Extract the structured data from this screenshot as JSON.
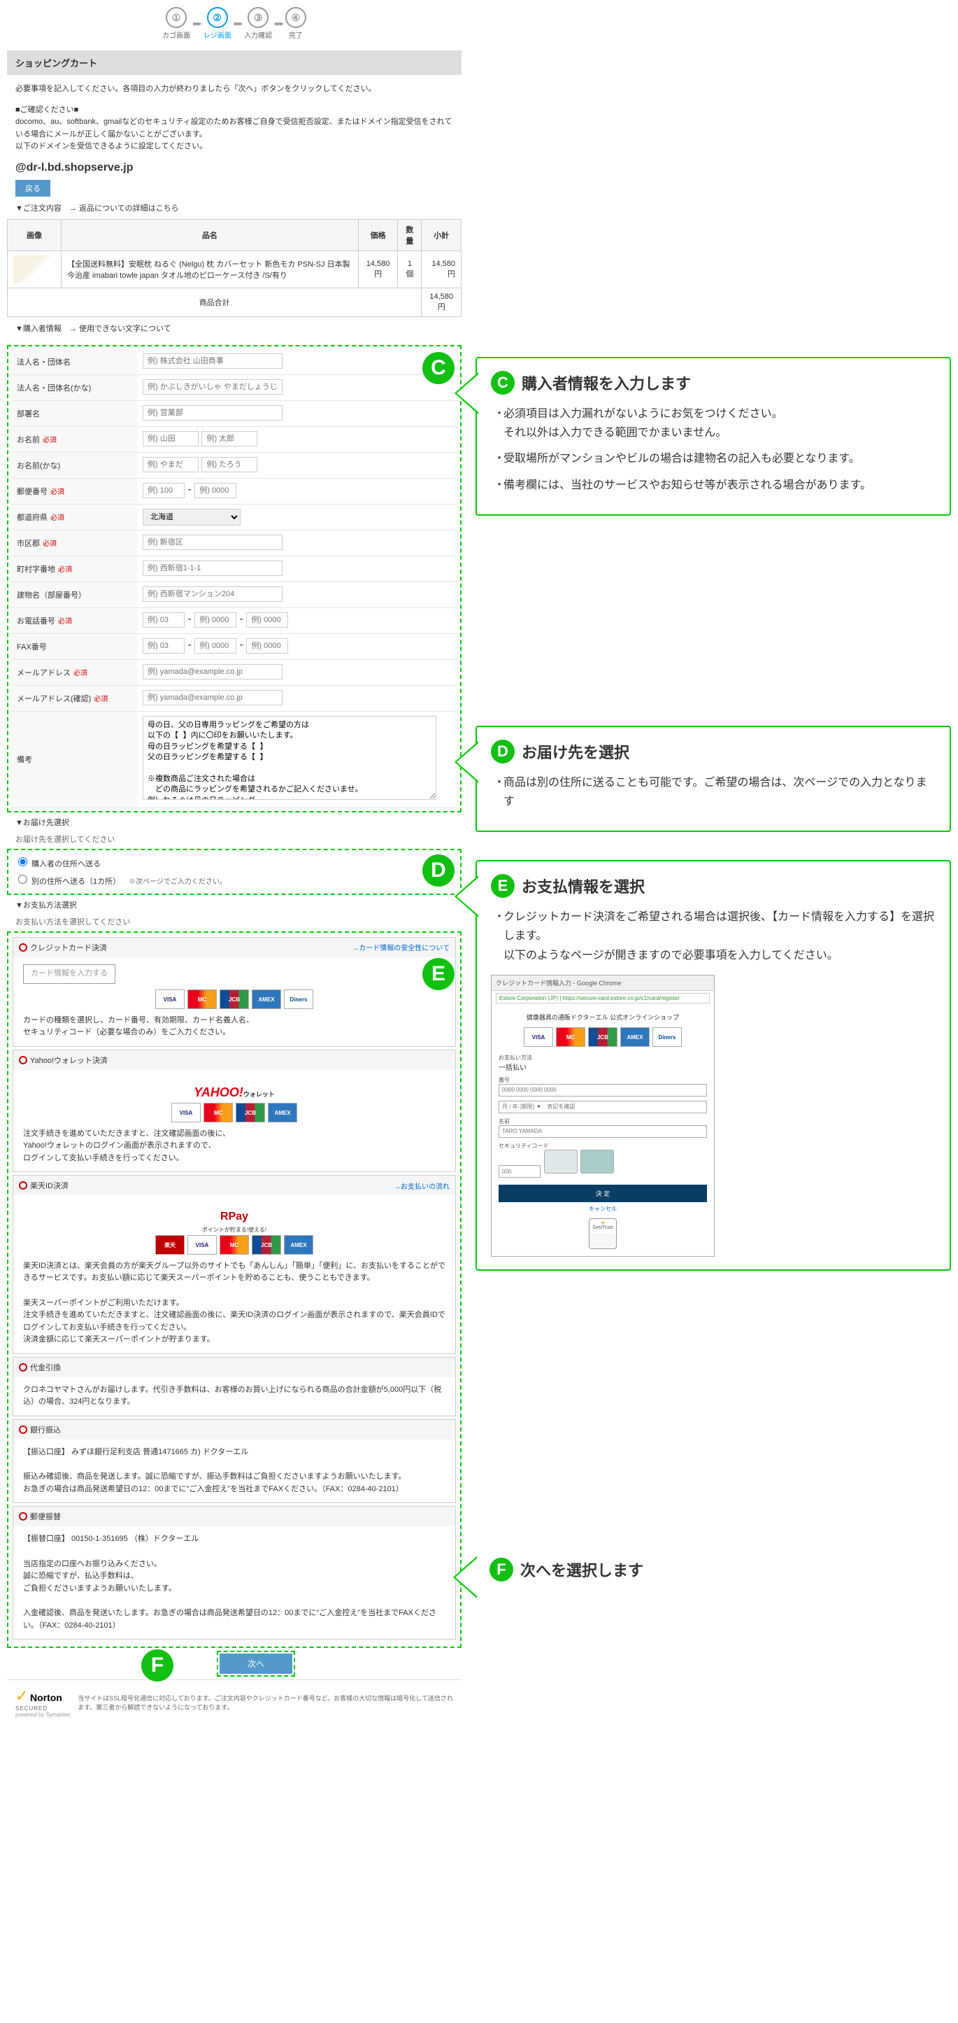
{
  "steps": [
    {
      "num": "①",
      "label": "カゴ画面"
    },
    {
      "num": "②",
      "label": "レジ画面"
    },
    {
      "num": "③",
      "label": "入力確認"
    },
    {
      "num": "④",
      "label": "完了"
    }
  ],
  "cart_header": "ショッピングカート",
  "intro": "必要事項を記入してください。各項目の入力が終わりましたら「次へ」ボタンをクリックしてください。",
  "confirm_title": "■ご確認ください■",
  "confirm_body": "docomo、au、softbank、gmailなどのセキュリティ設定のためお客様ご自身で受信拒否設定、またはドメイン指定受信をされている場合にメールが正しく届かないことがございます。\n以下のドメインを受信できるように設定してください。",
  "domain": "@dr-l.bd.shopserve.jp",
  "back_btn": "戻る",
  "order_link": "▼ご注文内容　→ 返品についての詳細はこちら",
  "order_table": {
    "headers": [
      "画像",
      "品名",
      "価格",
      "数量",
      "小計"
    ],
    "item_name": "【全国送料無料】安眠枕 ねるぐ (Nelgu) 枕 カバーセット 新色モカ PSN-SJ 日本製 今治産 imabari towle japan タオル地のピローケース付き /S/有り",
    "price": "14,580円",
    "qty": "1個",
    "subtotal": "14,580円",
    "total_label": "商品合計",
    "total": "14,580円"
  },
  "buyer_link": "▼購入者情報　→ 使用できない文字について",
  "form": {
    "company": {
      "label": "法人名・団体名",
      "ph": "例) 株式会社 山田商事"
    },
    "company_kana": {
      "label": "法人名・団体名(かな)",
      "ph": "例) かぶしきがいしゃ やまだしょうじ"
    },
    "dept": {
      "label": "部署名",
      "ph": "例) 営業部"
    },
    "name": {
      "label": "お名前",
      "ph1": "例) 山田",
      "ph2": "例) 太郎"
    },
    "name_kana": {
      "label": "お名前(かな)",
      "ph1": "例) やまだ",
      "ph2": "例) たろう"
    },
    "zip": {
      "label": "郵便番号",
      "ph1": "例) 100",
      "ph2": "例) 0000"
    },
    "pref": {
      "label": "都道府県",
      "val": "北海道"
    },
    "city": {
      "label": "市区郡",
      "ph": "例) 新宿区"
    },
    "town": {
      "label": "町村字番地",
      "ph": "例) 西新宿1-1-1"
    },
    "bldg": {
      "label": "建物名（部屋番号）",
      "ph": "例) 西新宿マンション204"
    },
    "tel": {
      "label": "お電話番号",
      "ph1": "例) 03",
      "ph2": "例) 0000",
      "ph3": "例) 0000"
    },
    "fax": {
      "label": "FAX番号",
      "ph1": "例) 03",
      "ph2": "例) 0000",
      "ph3": "例) 0000"
    },
    "mail": {
      "label": "メールアドレス",
      "ph": "例) yamada@example.co.jp"
    },
    "mail2": {
      "label": "メールアドレス(確認)",
      "ph": "例) yamada@example.co.jp"
    },
    "note": {
      "label": "備考",
      "val": "母の日、父の日専用ラッピングをご希望の方は\n以下の【 】内に〇印をお願いいたします。\n母の日ラッピングを希望する【 】\n父の日ラッピングを希望する【 】\n\n※複数商品ご注文された場合は\n　どの商品にラッピングを希望されるかご記入くださいませ。\n例）ねるぐは母の日ラッピング\n　　ドクターエルクッションは父の日ラッピング"
    },
    "req": "必須"
  },
  "delivery": {
    "header": "▼お届け先選択",
    "sub": "お届け先を選択してください",
    "opt1": "購入者の住所へ送る",
    "opt2": "別の住所へ送る（1カ所）",
    "note": "※次ページでご入力ください。"
  },
  "payment": {
    "header": "▼お支払方法選択",
    "sub": "お支払い方法を選択してください",
    "credit": {
      "title": "クレジットカード決済",
      "link": "→カード情報の安全性について",
      "btn": "カード情報を入力する",
      "desc": "カードの種類を選択し、カード番号、有効期限、カード名義人名、\nセキュリティコード（必要な場合のみ）をご入力ください。"
    },
    "yahoo": {
      "title": "Yahoo!ウォレット決済",
      "logo": "YAHOO!",
      "logo_sub": "ウォレット",
      "desc": "注文手続きを進めていただきますと、注文確認画面の後に、\nYahoo!ウォレットのログイン画面が表示されますので、\nログインして支払い手続きを行ってください。"
    },
    "rakuten": {
      "title": "楽天ID決済",
      "link": "→お支払いの流れ",
      "logo": "RPay",
      "logo_sub": "ポイントが貯まる!使える!",
      "desc1": "楽天ID決済とは、楽天会員の方が楽天グループ以外のサイトでも「あんしん」「簡単」「便利」に、お支払いをすることができるサービスです。お支払い額に応じて楽天スーパーポイントを貯めることも、使うこともできます。",
      "desc2": "楽天スーパーポイントがご利用いただけます。\n注文手続きを進めていただきますと、注文確認画面の後に、楽天ID決済のログイン画面が表示されますので、楽天会員IDでログインしてお支払い手続きを行ってください。\n決済金額に応じて楽天スーパーポイントが貯まります。"
    },
    "cod": {
      "title": "代金引換",
      "desc": "クロネコヤマトさんがお届けします。代引き手数料は、お客様のお買い上げになられる商品の合計金額が5,000円以下（税込）の場合、324円となります。"
    },
    "bank": {
      "title": "銀行振込",
      "acc": "【振込口座】 みずほ銀行足利支店 普通1471665 カ) ドクターエル",
      "desc": "振込み確認後、商品を発送します。誠に恐縮ですが、振込手数料はご負担くださいますようお願いいたします。\nお急ぎの場合は商品発送希望日の12：00までに\"ご入金控え\"を当社までFAXください。（FAX：0284-40-2101）"
    },
    "postal": {
      "title": "郵便振替",
      "acc": "【振替口座】 00150-1-351695 （株）ドクターエル",
      "desc1": "当店指定の口座へお振り込みください。\n誠に恐縮ですが、払込手数料は、\nご負担くださいますようお願いいたします。",
      "desc2": "入金確認後、商品を発送いたします。お急ぎの場合は商品発送希望日の12：00までに\"ご入金控え\"を当社までFAXください。（FAX：0284-40-2101）"
    }
  },
  "next_btn": "次へ",
  "norton": {
    "logo": "Norton",
    "secured": "SECURED",
    "powered": "powered by Symantec",
    "text": "当サイトはSSL暗号化通信に対応しております。ご注文内容やクレジットカード番号など、お客様の大切な情報は暗号化して送信されます。第三者から解読できないようになっております。"
  },
  "anno": {
    "c": {
      "badge": "C",
      "title": "購入者情報を入力します",
      "items": [
        "必須項目は入力漏れがないようにお気をつけください。\nそれ以外は入力できる範囲でかまいません。",
        "受取場所がマンションやビルの場合は建物名の記入も必要となります。",
        "備考欄には、当社のサービスやお知らせ等が表示される場合があります。"
      ]
    },
    "d": {
      "badge": "D",
      "title": "お届け先を選択",
      "items": [
        "商品は別の住所に送ることも可能です。ご希望の場合は、次ページでの入力となります"
      ]
    },
    "e": {
      "badge": "E",
      "title": "お支払情報を選択",
      "items": [
        "クレジットカード決済をご希望される場合は選択後、【カード情報を入力する】を選択します。\n以下のようなページが開きますので必要事項を入力してください。"
      ]
    },
    "f": {
      "badge": "F",
      "title": "次へを選択します"
    }
  },
  "mock": {
    "tab": "クレジットカード情報入力 - Google Chrome",
    "url": "Estore Corporation (JP) | https://secure-card.estore.co.jp/c1/card/register",
    "shop": "健康器具の通販ドクターエル 公式オンラインショップ",
    "method": "お支払い方法",
    "method_val": "一括払い",
    "num": "番号",
    "num_ph": "0000 0000 0000 0000",
    "exp": "月 / 年 (期限) ▼　表記を確認",
    "name": "名前",
    "name_ph": "TARO YAMADA",
    "sec": "セキュリティコード",
    "sec_ph": "000",
    "submit": "決 定",
    "cancel": "キャンセル",
    "trust": "GeoTrust"
  }
}
